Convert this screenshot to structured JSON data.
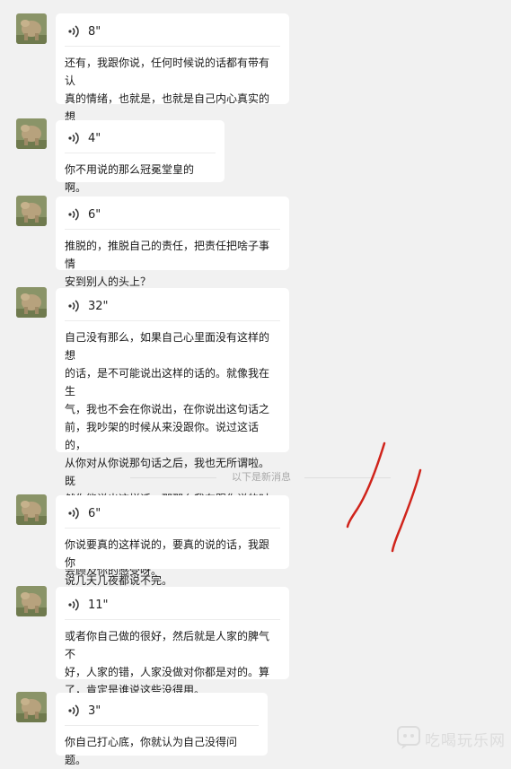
{
  "messages": [
    {
      "duration": "8\"",
      "text": "还有，我跟你说，任何时候说的话都有带有认\n真的情绪，也就是，也就是自己内心真实的想\n法。"
    },
    {
      "duration": "4\"",
      "text": "你不用说的那么冠冕堂皇的啊。"
    },
    {
      "duration": "6\"",
      "text": "推脱的，推脱自己的责任，把责任把啥子事情\n安到别人的头上？"
    },
    {
      "duration": "32\"",
      "text": "自己没有那么，如果自己心里面没有这样的想\n的话，是不可能说出这样的话的。就像我在生\n气，我也不会在你说出，在你说出这句话之\n前，我吵架的时候从来没跟你。说过这话的，\n从你对从你说那句话之后，我也无所谓啦。既\n然你能说出这样话，那那么我在跟你说的时候\n也一样的，我只会只顾及自己的感受，我也不\n会顾及你的感受呀。"
    },
    {
      "duration": "6\"",
      "text": "你说要真的这样说的，要真的说的话，我跟你\n说几天几夜都说不完。"
    },
    {
      "duration": "11\"",
      "text": "或者你自己做的很好，然后就是人家的脾气不\n好，人家的错，人家没做对你都是对的。算\n了，肯定是谁说这些没得用。"
    },
    {
      "duration": "3\"",
      "text": "你自己打心底，你就认为自己没得问题。"
    }
  ],
  "divider_label": "以下是新消息",
  "watermark": "吃喝玩乐网",
  "colors": {
    "background": "#f1f1f1",
    "bubble": "#ffffff",
    "annotation": "#d0241b"
  }
}
